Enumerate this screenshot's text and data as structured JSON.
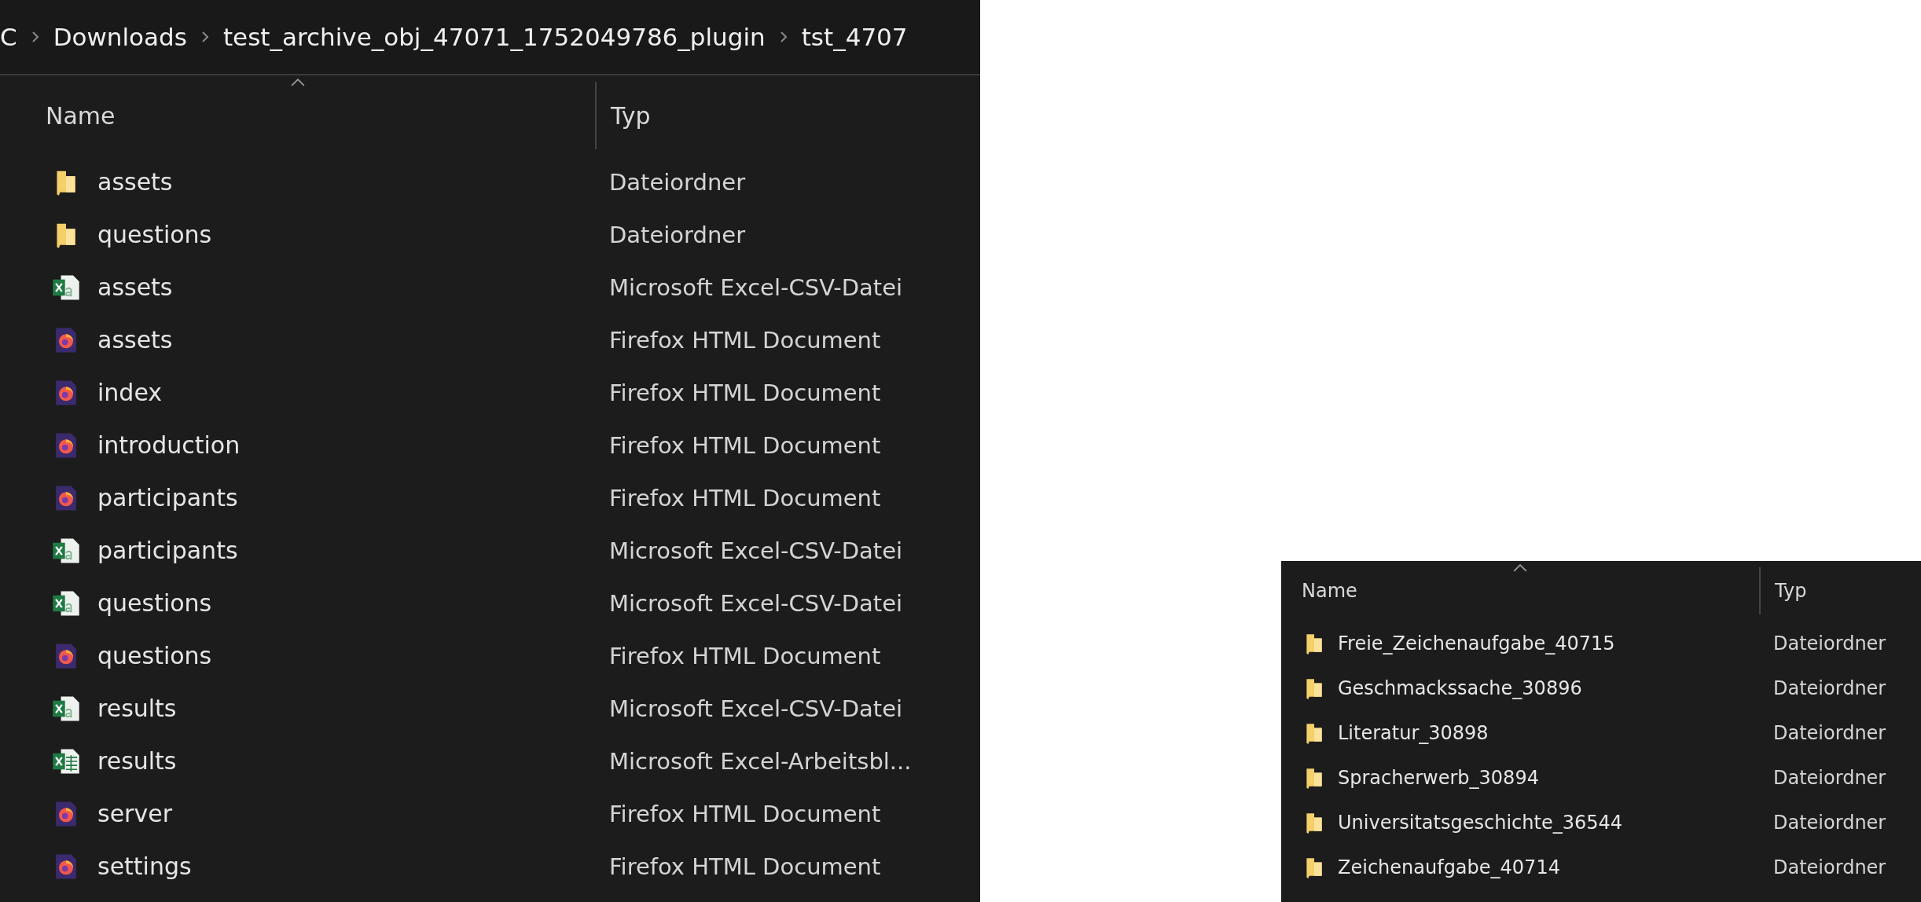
{
  "left_window": {
    "breadcrumb": [
      "C",
      "Downloads",
      "test_archive_obj_47071_1752049786_plugin",
      "tst_4707"
    ],
    "columns": [
      {
        "label": "Name",
        "sorted": true
      },
      {
        "label": "Typ",
        "sorted": false
      }
    ],
    "rows": [
      {
        "kind": "folder",
        "name": "assets",
        "type": "Dateiordner"
      },
      {
        "kind": "folder",
        "name": "questions",
        "type": "Dateiordner"
      },
      {
        "kind": "csv",
        "name": "assets",
        "type": "Microsoft Excel-CSV-Datei"
      },
      {
        "kind": "html",
        "name": "assets",
        "type": "Firefox HTML Document"
      },
      {
        "kind": "html",
        "name": "index",
        "type": "Firefox HTML Document"
      },
      {
        "kind": "html",
        "name": "introduction",
        "type": "Firefox HTML Document"
      },
      {
        "kind": "html",
        "name": "participants",
        "type": "Firefox HTML Document"
      },
      {
        "kind": "csv",
        "name": "participants",
        "type": "Microsoft Excel-CSV-Datei"
      },
      {
        "kind": "csv",
        "name": "questions",
        "type": "Microsoft Excel-CSV-Datei"
      },
      {
        "kind": "html",
        "name": "questions",
        "type": "Firefox HTML Document"
      },
      {
        "kind": "csv",
        "name": "results",
        "type": "Microsoft Excel-CSV-Datei"
      },
      {
        "kind": "xlsx",
        "name": "results",
        "type": "Microsoft Excel-Arbeitsbl..."
      },
      {
        "kind": "html",
        "name": "server",
        "type": "Firefox HTML Document"
      },
      {
        "kind": "html",
        "name": "settings",
        "type": "Firefox HTML Document"
      }
    ]
  },
  "right_window": {
    "columns": [
      {
        "label": "Name",
        "sorted": true
      },
      {
        "label": "Typ",
        "sorted": false
      }
    ],
    "rows": [
      {
        "kind": "folder",
        "name": "Freie_Zeichenaufgabe_40715",
        "type": "Dateiordner"
      },
      {
        "kind": "folder",
        "name": "Geschmackssache_30896",
        "type": "Dateiordner"
      },
      {
        "kind": "folder",
        "name": "Literatur_30898",
        "type": "Dateiordner"
      },
      {
        "kind": "folder",
        "name": "Spracherwerb_30894",
        "type": "Dateiordner"
      },
      {
        "kind": "folder",
        "name": "Universitatsgeschichte_36544",
        "type": "Dateiordner"
      },
      {
        "kind": "folder",
        "name": "Zeichenaufgabe_40714",
        "type": "Dateiordner"
      }
    ]
  }
}
